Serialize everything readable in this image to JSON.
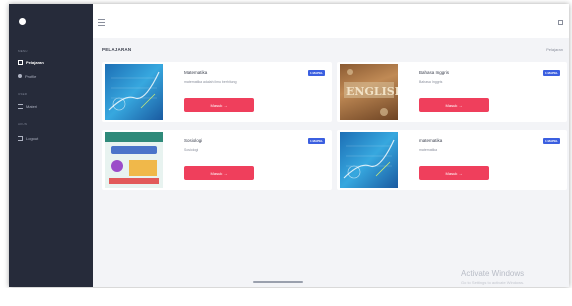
{
  "sidebar": {
    "groups": [
      "MENU",
      "USER",
      "AKUN"
    ],
    "items": [
      {
        "label": "Pelajaran",
        "icon": "grid-icon"
      },
      {
        "label": "Profile",
        "icon": "user-icon"
      },
      {
        "label": "Materi",
        "icon": "list-icon"
      },
      {
        "label": "Logout",
        "icon": "logout-icon"
      }
    ]
  },
  "header": {
    "page_title": "PELAJARAN",
    "breadcrumb": "Pelajaran"
  },
  "courses": [
    {
      "title": "Matematika",
      "subtitle": "matematika adalah ilmu berhitung",
      "badge": "1 MAPEL",
      "button": "Masuk →"
    },
    {
      "title": "Bahasa Inggris",
      "subtitle": "Bahasa Inggris",
      "badge": "1 MAPEL",
      "button": "Masuk →"
    },
    {
      "title": "Sosiologi",
      "subtitle": "Sosiologi",
      "badge": "1 MAPEL",
      "button": "Masuk →"
    },
    {
      "title": "matematika",
      "subtitle": "matematika",
      "badge": "1 MAPEL",
      "button": "Masuk →"
    }
  ],
  "watermark": {
    "line1": "Activate Windows",
    "line2": "Go to Settings to activate Windows."
  }
}
